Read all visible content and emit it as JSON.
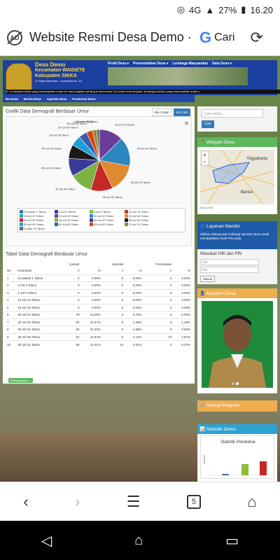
{
  "status": {
    "signal": "4G",
    "battery": "27%",
    "time": "16.20"
  },
  "browser": {
    "title": "Website Resmi Desa Demo ·",
    "search_label": "Cari"
  },
  "site": {
    "name": "Desa Demo",
    "kecamatan": "Kecamatan WAIGETE",
    "kabupaten": "Kabupaten SIKKA",
    "address": "Jl. Raya Maumere - Larantuka No. 24",
    "top_nav": [
      "Profil Desa ▾",
      "Pemerintahan Desa ▾",
      "Lembaga Masyarakat",
      "Data Desa ▾"
    ],
    "marquee": "ni. Ini dengan tulisan yang menampilkan suatu ciri atau kegiatan penting di desa anda.        Ini contoh teks berjalan. Isi dengan tulisan yang menampilkan suatu c",
    "main_nav": [
      "Beranda",
      "Berita Desa",
      "Agenda Desa",
      "Peraturan Desa"
    ]
  },
  "chart_panel": {
    "title": "Grafik Data Demografi Berdasar Umur",
    "tab_bar": "Bar Graph",
    "tab_pie": "Pie Cart"
  },
  "chart_data": {
    "type": "pie",
    "title": "",
    "categories": [
      "Di bawah 1 Tahun",
      "2 s/d 4 Tahun",
      "5 s/d 9 Tahun",
      "10 s/d 14 Tahun",
      "15 s/d 19 Tahun",
      "20 s/d 24 Tahun",
      "25 s/d 29 Tahun",
      "30 s/d 34 Tahun",
      "35 s/d 39 Tahun",
      "40 s/d 44 Tahun",
      "45 s/d 49 Tahun",
      "50 s/d 54 Tahun",
      "55 s/d 59 Tahun",
      "60 s/d 64 Tahun",
      "65 s/d 69 Tahun",
      "70 s/d 74 Tahun",
      "Di atas 75 Tahun"
    ],
    "values": [
      0,
      0,
      0,
      0,
      0,
      70,
      84,
      82,
      64,
      66,
      52,
      40,
      30,
      24,
      18,
      12,
      8
    ],
    "colors": [
      "#4572a7",
      "#3d3d8a",
      "#8fbc3a",
      "#c0392b",
      "#2aa3d0",
      "#6a3d9a",
      "#2e86c1",
      "#e08a2e",
      "#c62828",
      "#7cb342",
      "#3a3a9a",
      "#1a1a1a",
      "#1e9fd8",
      "#3b5da8",
      "#d84315",
      "#9a8a2a",
      "#546e7a"
    ],
    "legend": "bottom"
  },
  "table_panel": {
    "title": "Tabel Data Demografi Berdasar Umur",
    "headers": {
      "no": "No",
      "kelompok": "Kelompok",
      "jumlah": "Jumlah",
      "laki": "Laki-laki",
      "perempuan": "Perempuan",
      "n": "n",
      "pct": "%"
    },
    "rows": [
      [
        "1",
        "Di bawah 1 Tahun",
        "0",
        "0.00%",
        "0",
        "0.00%",
        "0",
        "0.00%"
      ],
      [
        "2",
        "2 s/d 4 Tahun",
        "0",
        "0.00%",
        "0",
        "0.00%",
        "0",
        "0.00%"
      ],
      [
        "3",
        "5 s/d 9 Tahun",
        "0",
        "0.00%",
        "0",
        "0.00%",
        "0",
        "0.00%"
      ],
      [
        "4",
        "10 s/d 14 Tahun",
        "0",
        "0.00%",
        "0",
        "0.00%",
        "0",
        "0.00%"
      ],
      [
        "5",
        "15 s/d 19 Tahun",
        "0",
        "0.00%",
        "0",
        "0.00%",
        "0",
        "0.00%"
      ],
      [
        "6",
        "20 s/d 24 Tahun",
        "70",
        "13.06%",
        "4",
        "0.75%",
        "5",
        "0.93%"
      ],
      [
        "7",
        "25 s/d 29 Tahun",
        "84",
        "15.67%",
        "8",
        "1.49%",
        "8",
        "1.49%"
      ],
      [
        "8",
        "30 s/d 34 Tahun",
        "82",
        "15.30%",
        "9",
        "1.68%",
        "5",
        "0.93%"
      ],
      [
        "9",
        "35 s/d 39 Tahun",
        "64",
        "11.94%",
        "6",
        "1.12%",
        "10",
        "1.87%"
      ],
      [
        "10",
        "40 s/d 44 Tahun",
        "66",
        "12.31%",
        "14",
        "2.61%",
        "2",
        "0.37%"
      ]
    ],
    "more_button": "Selengkapnya..."
  },
  "sidebar": {
    "search_placeholder": "Cari artikel...",
    "search_button": "Cari",
    "wilayah_title": "📍 Wilayah Desa",
    "map_labels": [
      "Yogyakarta",
      "Bantul"
    ],
    "map_note": "Buka peta",
    "layanan_title": "👤 Layanan Mandiri",
    "layanan_text": "Silakan datang atau hubungi operator desa untuk mendapatkan kode PIN anda.",
    "nik_label": "Masukan NIK dan PIN",
    "nik_placeholder": "NIK",
    "pin_placeholder": "PIN",
    "login_button": "Masuk",
    "aparatur_title": "👤 Aparatur Desa",
    "sinergi_title": "🔗 Sinergi Program",
    "statistik_title": "📊 Statistik Demo",
    "statistik_chart_title": "Statistik Penduduk",
    "statistik_ylabel": "Jumlah",
    "accent_green": "#5cb85c",
    "accent_blue": "#337ab7",
    "accent_orange": "#f0ad4e"
  },
  "navbar": {
    "tabs_count": "5"
  }
}
